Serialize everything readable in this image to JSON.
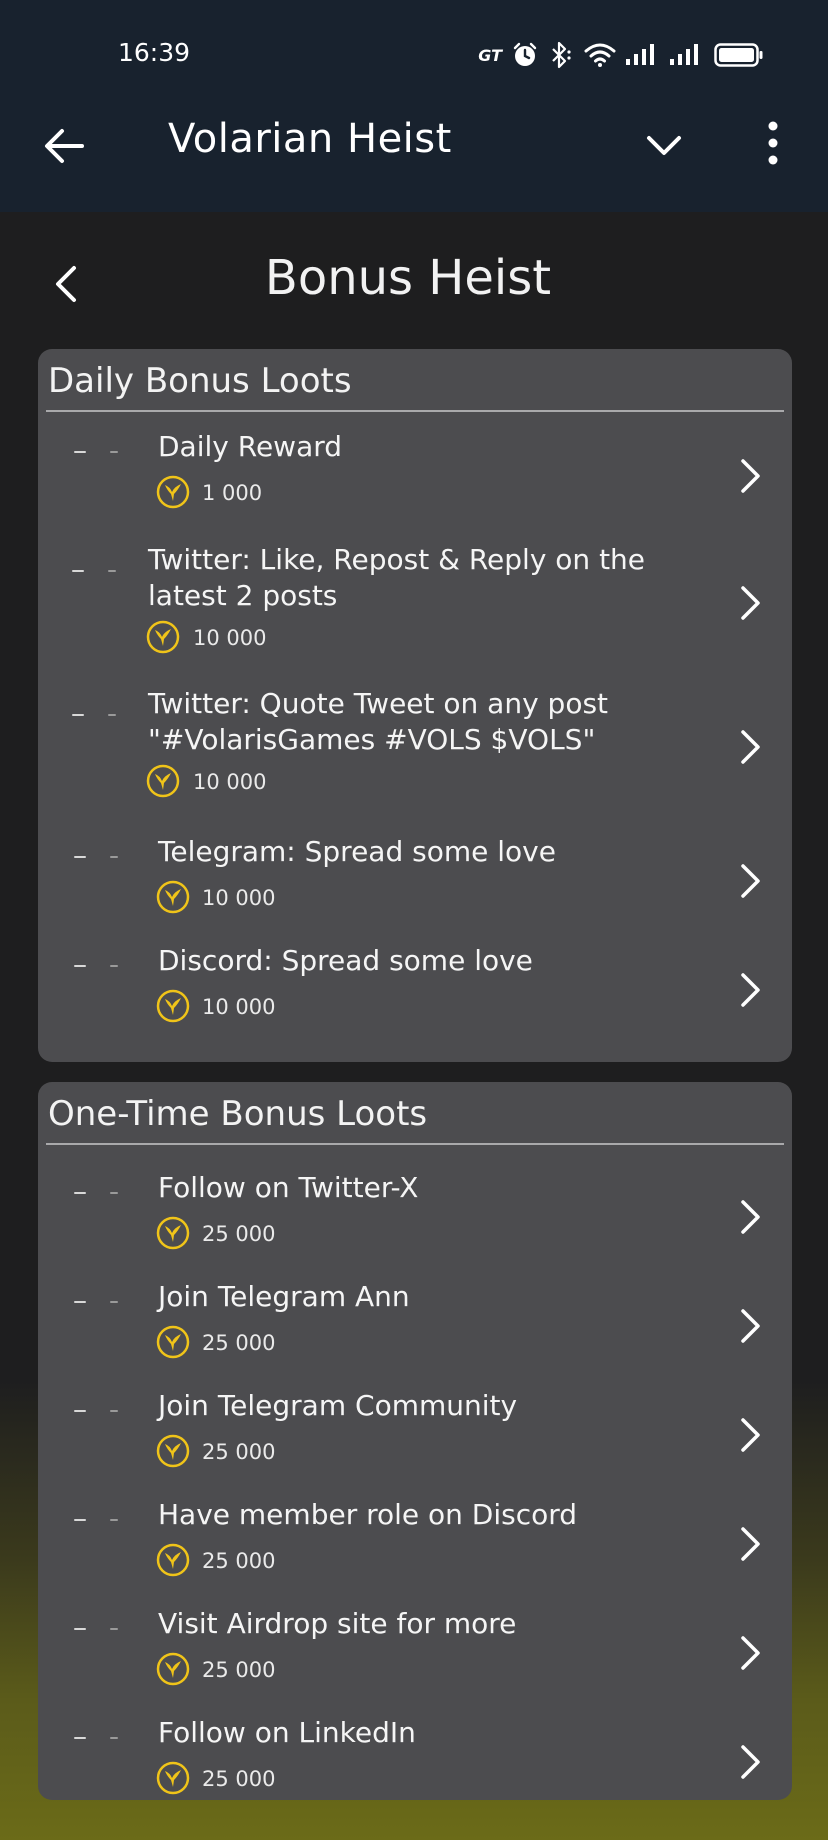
{
  "status_bar": {
    "time": "16:39",
    "carrier_badge": "GT",
    "icons": [
      "alarm-icon",
      "bluetooth-icon",
      "wifi-icon",
      "signal-icon",
      "signal-icon",
      "battery-icon"
    ]
  },
  "app_bar": {
    "title": "Volarian Heist",
    "icons": [
      "back-arrow-icon",
      "chevron-down-icon",
      "more-vert-icon"
    ]
  },
  "page": {
    "title": "Bonus Heist"
  },
  "colors": {
    "status_bar_bg": "#18222e",
    "page_bg": "#1e1e1f",
    "card_bg": "#4c4c4f",
    "coin_color": "#f0c419",
    "bottom_glow": "#6b6b18"
  },
  "daily": {
    "title": "Daily Bonus Loots",
    "items": [
      {
        "label": "Daily Reward",
        "amount": "1 000"
      },
      {
        "label": "Twitter: Like, Repost & Reply on the latest 2 posts",
        "amount": "10 000"
      },
      {
        "label": "Twitter: Quote Tweet on any post \"#VolarisGames #VOLS $VOLS\"",
        "amount": "10 000"
      },
      {
        "label": "Telegram: Spread some love",
        "amount": "10 000"
      },
      {
        "label": "Discord: Spread some love",
        "amount": "10 000"
      }
    ]
  },
  "onetime": {
    "title": "One-Time Bonus Loots",
    "items": [
      {
        "label": "Follow on Twitter-X",
        "amount": "25 000"
      },
      {
        "label": "Join Telegram Ann",
        "amount": "25 000"
      },
      {
        "label": "Join Telegram Community",
        "amount": "25 000"
      },
      {
        "label": "Have member role on Discord",
        "amount": "25 000"
      },
      {
        "label": "Visit Airdrop site for more",
        "amount": "25 000"
      },
      {
        "label": "Follow on LinkedIn",
        "amount": "25 000"
      }
    ]
  }
}
